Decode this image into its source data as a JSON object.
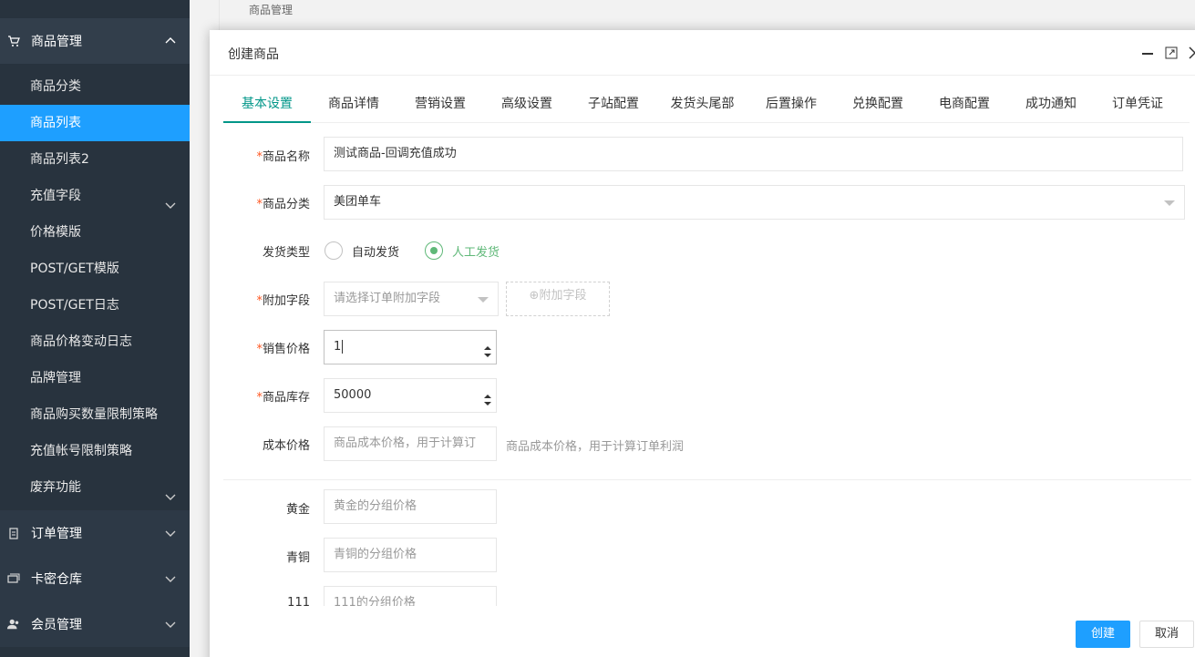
{
  "sidebar": {
    "top_partial": "",
    "group_product": "商品管理",
    "items": [
      {
        "label": "商品分类"
      },
      {
        "label": "商品列表"
      },
      {
        "label": "商品列表2"
      },
      {
        "label": "充值字段"
      },
      {
        "label": "价格模版"
      },
      {
        "label": "POST/GET模版"
      },
      {
        "label": "POST/GET日志"
      },
      {
        "label": "商品价格变动日志"
      },
      {
        "label": "品牌管理"
      },
      {
        "label": "商品购买数量限制策略"
      },
      {
        "label": "充值帐号限制策略"
      },
      {
        "label": "废弃功能"
      }
    ],
    "group_orders": "订单管理",
    "group_cards": "卡密仓库",
    "group_members": "会员管理"
  },
  "background": {
    "legend": "商品管理"
  },
  "modal": {
    "title": "创建商品",
    "tabs": [
      "基本设置",
      "商品详情",
      "营销设置",
      "高级设置",
      "子站配置",
      "发货头尾部",
      "后置操作",
      "兑换配置",
      "电商配置",
      "成功通知",
      "订单凭证"
    ],
    "fields": {
      "name_label": "商品名称",
      "name_value": "测试商品-回调充值成功",
      "category_label": "商品分类",
      "category_value": "美团单车",
      "delivery_label": "发货类型",
      "delivery_auto": "自动发货",
      "delivery_manual": "人工发货",
      "extra_label": "附加字段",
      "extra_placeholder": "请选择订单附加字段",
      "extra_button": "附加字段",
      "price_label": "销售价格",
      "price_value": "1",
      "stock_label": "商品库存",
      "stock_value": "50000",
      "cost_label": "成本价格",
      "cost_placeholder": "商品成本价格，用于计算订",
      "cost_hint": "商品成本价格，用于计算订单利润"
    },
    "group_prices": [
      {
        "label": "黄金",
        "placeholder": "黄金的分组价格"
      },
      {
        "label": "青铜",
        "placeholder": "青铜的分组价格"
      },
      {
        "label": "111",
        "placeholder": "111的分组价格"
      }
    ],
    "buttons": {
      "create": "创建",
      "cancel": "取消"
    }
  }
}
